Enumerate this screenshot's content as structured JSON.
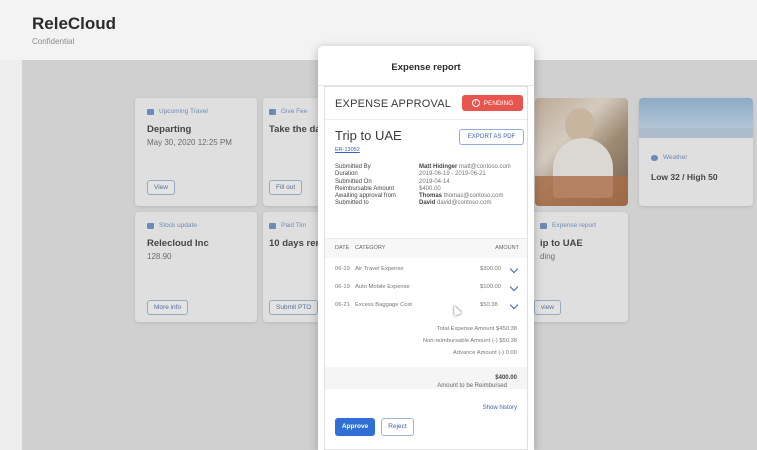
{
  "app": {
    "title": "ReleCloud",
    "subtitle": "Confidential"
  },
  "cards": {
    "travel": {
      "head": "Upcoming Travel",
      "title": "Departing",
      "text": "May 30, 2020 12:25 PM",
      "button": "View"
    },
    "task": {
      "head": "Give Fee",
      "title": "Take the da",
      "button": "Fill out"
    },
    "stock": {
      "head": "Stock update",
      "title": "Relecloud Inc",
      "text": "128.90",
      "button": "More info"
    },
    "pto": {
      "head": "Paid Tim",
      "title": "10 days rem",
      "button": "Submit PTO"
    },
    "expense": {
      "head": "Expense report",
      "title": "ip to UAE",
      "text": "ding",
      "button": "view"
    },
    "weather": {
      "head": "Weather",
      "title": "Low 32 / High 50"
    }
  },
  "modal": {
    "title": "Expense report",
    "header": "EXPENSE APPROVAL",
    "status": "PENDING",
    "trip": "Trip to UAE",
    "trip_id": "ER-13052",
    "export_label": "EXPORT AS PDF",
    "details": [
      {
        "key": "Submitted By",
        "value": "Matt Hidinger",
        "extra": "matt@contoso.com"
      },
      {
        "key": "Duration",
        "value": "",
        "extra": "2019-06-19 - 2019-06-21"
      },
      {
        "key": "Submitted On",
        "value": "",
        "extra": "2019-04-14"
      },
      {
        "key": "Reimbursable Amount",
        "value": "",
        "extra": "$400.00"
      },
      {
        "key": "Awaiting approval from",
        "value": "Thomas",
        "extra": "thomas@contoso.com"
      },
      {
        "key": "Submitted to",
        "value": "David",
        "extra": "david@contoso.com"
      }
    ],
    "table": {
      "headers": {
        "date": "DATE",
        "category": "CATEGORY",
        "amount": "AMOUNT"
      },
      "rows": [
        {
          "date": "06-19",
          "category": "Air Travel Expense",
          "amount": "$300.00"
        },
        {
          "date": "06-19",
          "category": "Auto Mobile Expense",
          "amount": "$100.00"
        },
        {
          "date": "06-21",
          "category": "Excess Baggage Cost",
          "amount": "$50.38"
        }
      ]
    },
    "totals": [
      {
        "label": "Total Expense Amount",
        "value": "$450.38"
      },
      {
        "label": "Non-reimbursable Amount",
        "value": "(-) $50.38"
      },
      {
        "label": "Advance Amount",
        "value": "(-) 0.00"
      }
    ],
    "reimbursed_label": "Amount to be Reimbursed",
    "reimbursed_value": "$400.00",
    "show_history": "Show history",
    "approve_label": "Approve",
    "reject_label": "Reject"
  },
  "colors": {
    "accent": "#2f6fd6",
    "pending": "#e8544e",
    "link": "#3b63b5"
  }
}
